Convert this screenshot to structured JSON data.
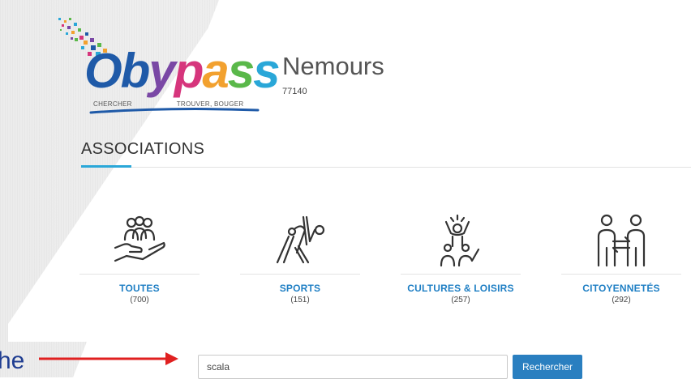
{
  "logo": {
    "word_parts": [
      "Ob",
      "y",
      "p",
      "a",
      "s",
      "s"
    ],
    "tagline_left": "CHERCHER",
    "tagline_right": "TROUVER, BOUGER",
    "colors": {
      "blue": "#1f5aa8",
      "purple": "#7a48a5",
      "pink": "#d6357c",
      "orange": "#f2a12f",
      "green": "#5ab84a",
      "cyan": "#2aa7d8"
    }
  },
  "city": {
    "name": "Nemours",
    "zip": "77140"
  },
  "section": {
    "title": "ASSOCIATIONS"
  },
  "categories": [
    {
      "label": "TOUTES",
      "count": "(700)",
      "icon": "people-in-hand-icon"
    },
    {
      "label": "SPORTS",
      "count": "(151)",
      "icon": "gymnast-ball-icon"
    },
    {
      "label": "CULTURES & LOISIRS",
      "count": "(257)",
      "icon": "celebrating-people-icon"
    },
    {
      "label": "CITOYENNETÉS",
      "count": "(292)",
      "icon": "two-citizens-exchange-icon"
    }
  ],
  "search": {
    "annotation_label": "rche",
    "value": "scala",
    "button_label": "Rechercher"
  },
  "colors": {
    "accent": "#1f7fc4",
    "button": "#2a7fc0",
    "annotation_text": "#1f3d91",
    "annotation_arrow": "#e02020"
  }
}
